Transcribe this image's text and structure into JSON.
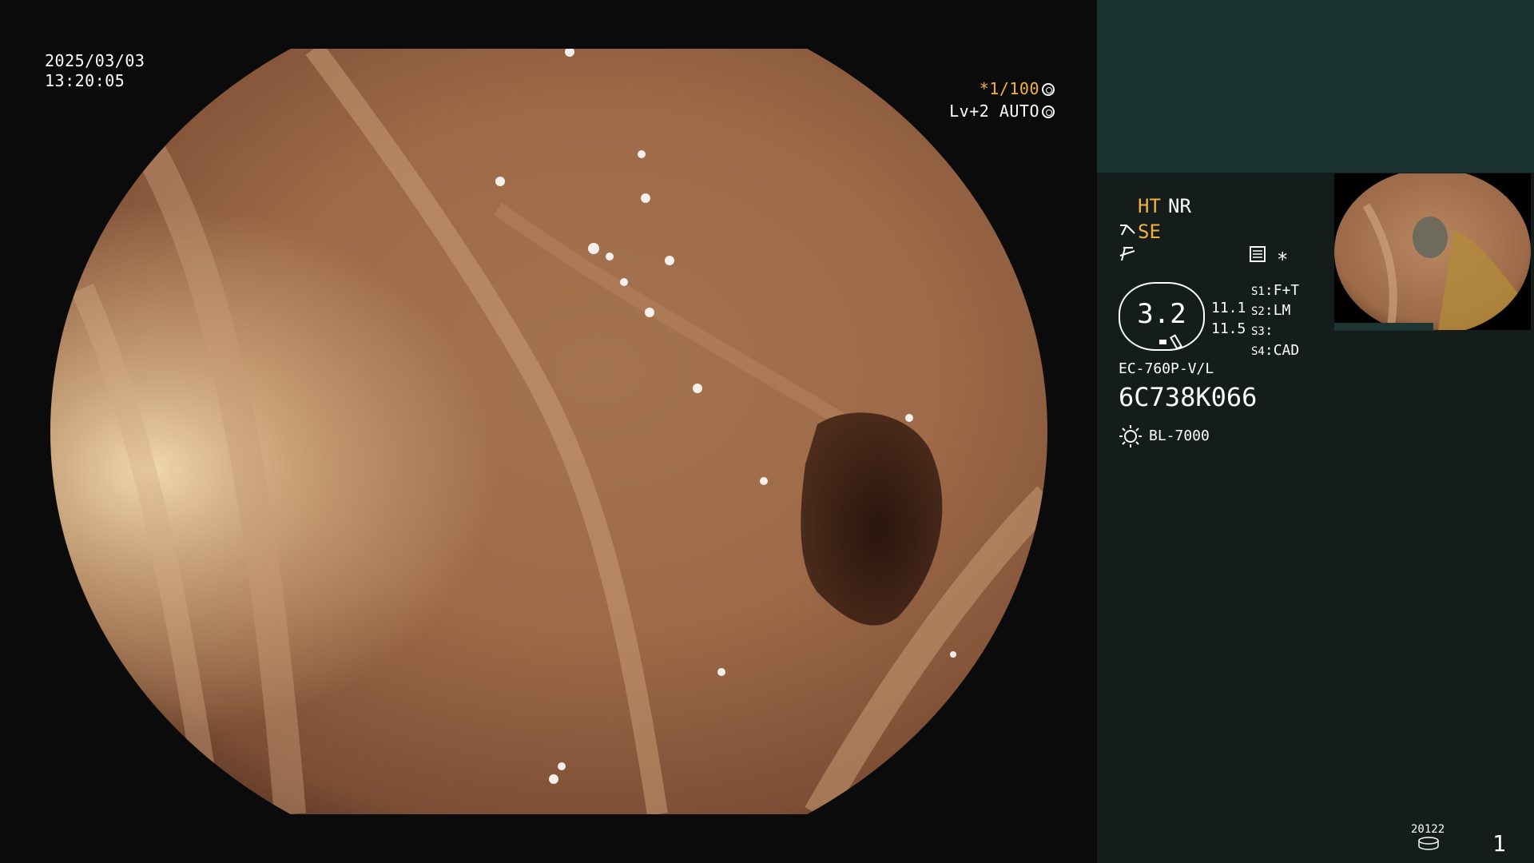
{
  "overlay": {
    "date": "2025/03/03",
    "time": "13:20:05",
    "shutter": "*1/100",
    "level": "Lv+2",
    "mode": "AUTO"
  },
  "panel": {
    "ht": "HT",
    "nr": "NR",
    "se": "SE",
    "gauge_value": "3.2",
    "val_a": "11.1",
    "val_b": "11.5",
    "s_labels": [
      "S1",
      "S2",
      "S3",
      "S4"
    ],
    "s_values": [
      "F+T",
      "LM",
      "",
      "CAD"
    ],
    "scope_model": "EC-760P-V/L",
    "serial": "6C738K066",
    "light_source": "BL-7000",
    "counter_label": "20122",
    "page_number": "1"
  },
  "icons": {
    "shutter_icon": "aperture-icon",
    "auto_icon": "target-circle-icon",
    "se_icon": "scope-tip-icon",
    "f_icon": "focus-slash-icon",
    "memo_icon": "list-sheet-icon",
    "star_icon": "asterisk-icon",
    "light_icon": "sun-lamp-icon",
    "disk_icon": "disk-stack-icon"
  },
  "colors": {
    "accent_yellow": "#f2b23a",
    "panel_top": "#1a3330",
    "panel_bottom": "#141d1b"
  }
}
